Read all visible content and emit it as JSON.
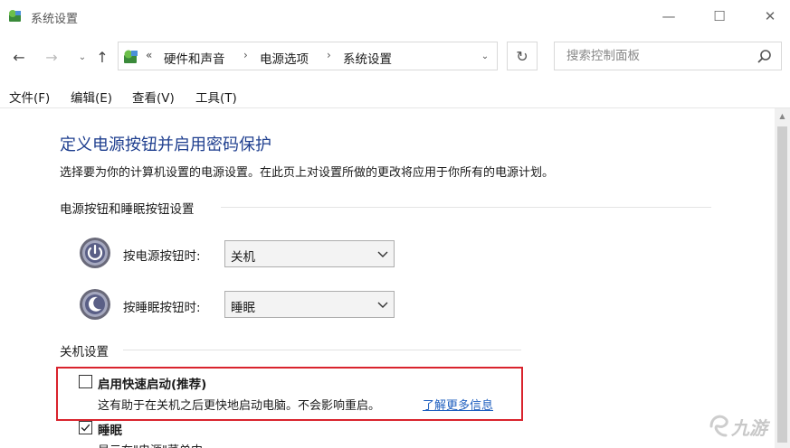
{
  "window": {
    "title": "系统设置",
    "minimize_glyph": "—",
    "maximize_glyph": "☐",
    "close_glyph": "✕"
  },
  "nav": {
    "back_glyph": "←",
    "forward_glyph": "→",
    "recent_glyph": "⌄",
    "up_glyph": "↑"
  },
  "address": {
    "chevrons": "«",
    "crumbs": [
      "硬件和声音",
      "电源选项",
      "系统设置"
    ],
    "separator": "›",
    "dropdown_glyph": "⌄",
    "refresh_glyph": "↻"
  },
  "search": {
    "placeholder": "搜索控制面板"
  },
  "menu": {
    "items": [
      "文件(F)",
      "编辑(E)",
      "查看(V)",
      "工具(T)"
    ]
  },
  "page": {
    "title": "定义电源按钮并启用密码保护",
    "description": "选择要为你的计算机设置的电源设置。在此页上对设置所做的更改将应用于你所有的电源计划。"
  },
  "power_buttons": {
    "header": "电源按钮和睡眠按钮设置",
    "power_label": "按电源按钮时:",
    "power_value": "关机",
    "sleep_label": "按睡眠按钮时:",
    "sleep_value": "睡眠"
  },
  "shutdown": {
    "header": "关机设置",
    "fast_startup_label": "启用快速启动(推荐)",
    "fast_startup_checked": false,
    "fast_startup_desc": "这有助于在关机之后更快地启动电脑。不会影响重启。",
    "learn_more": "了解更多信息",
    "sleep_label": "睡眠",
    "sleep_checked": true,
    "sleep_desc": "显示在\"电源\"菜单中。"
  },
  "watermark": {
    "text": "九游"
  },
  "colors": {
    "title_blue": "#1f3f8f",
    "link_blue": "#1f5fbf",
    "highlight_red": "#d9232d"
  }
}
